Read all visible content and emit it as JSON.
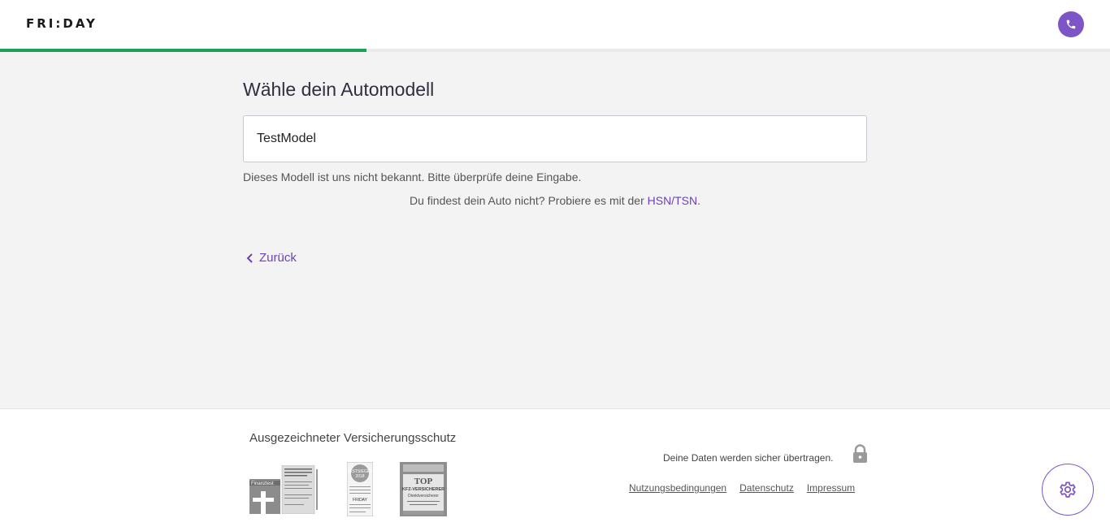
{
  "header": {
    "logo_text": "FRI:DAY",
    "phone_icon": "phone-icon",
    "progress_fraction": 0.33,
    "progress_color": "#1e9e57"
  },
  "main": {
    "title": "Wähle dein Automodell",
    "model_input_value": "TestModel",
    "error_message": "Dieses Modell ist uns nicht bekannt. Bitte überprüfe deine Eingabe.",
    "hint_text": "Du findest dein Auto nicht? Probiere es mit der ",
    "hint_link": "HSN/TSN",
    "hint_suffix": ".",
    "back_label": "Zurück",
    "back_icon": "chevron-left-icon"
  },
  "footer": {
    "awards_title": "Ausgezeichneter Versicherungsschutz",
    "badges": [
      {
        "name": "finanztest-badge",
        "label": "Finanztest"
      },
      {
        "name": "testsieger-badge",
        "label": "TESTSIEGER 2018",
        "sublabel": "FRIDAY"
      },
      {
        "name": "focus-money-badge",
        "label": "TOP KFZ-VERSICHERER",
        "sublabel": "Direktversicherer"
      }
    ],
    "secure_text": "Deine Daten werden sicher übertragen.",
    "lock_icon": "lock-icon",
    "links": [
      "Nutzungsbedingungen",
      "Datenschutz",
      "Impressum"
    ],
    "cookie_icon": "gear-icon"
  },
  "colors": {
    "accent": "#7d55c7",
    "link": "#6a42b8",
    "progress": "#1e9e57",
    "background": "#f3f3f3"
  }
}
